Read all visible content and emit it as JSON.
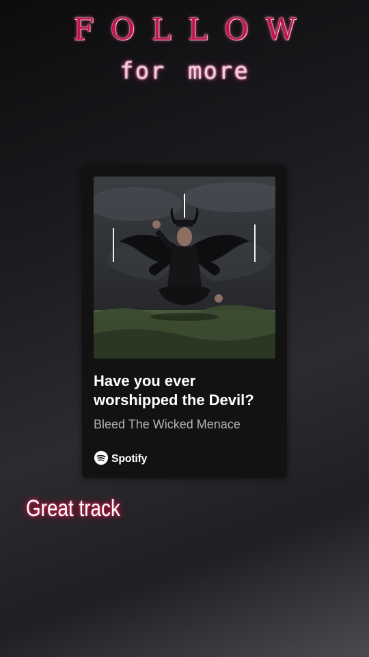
{
  "overlay": {
    "follow_text": "FOLLOW",
    "follow_sub": "for more"
  },
  "card": {
    "track_title": "Have you ever worshipped the Devil?",
    "artist": "Bleed The Wicked Menace",
    "brand": "Spotify",
    "brand_icon": "spotify-logo-icon",
    "artwork_icon": "album-art-winged-figure"
  },
  "caption": "Great track",
  "colors": {
    "follow_text": "#c2144e",
    "card_bg": "#121212",
    "caption_glow": "#c2144e"
  }
}
